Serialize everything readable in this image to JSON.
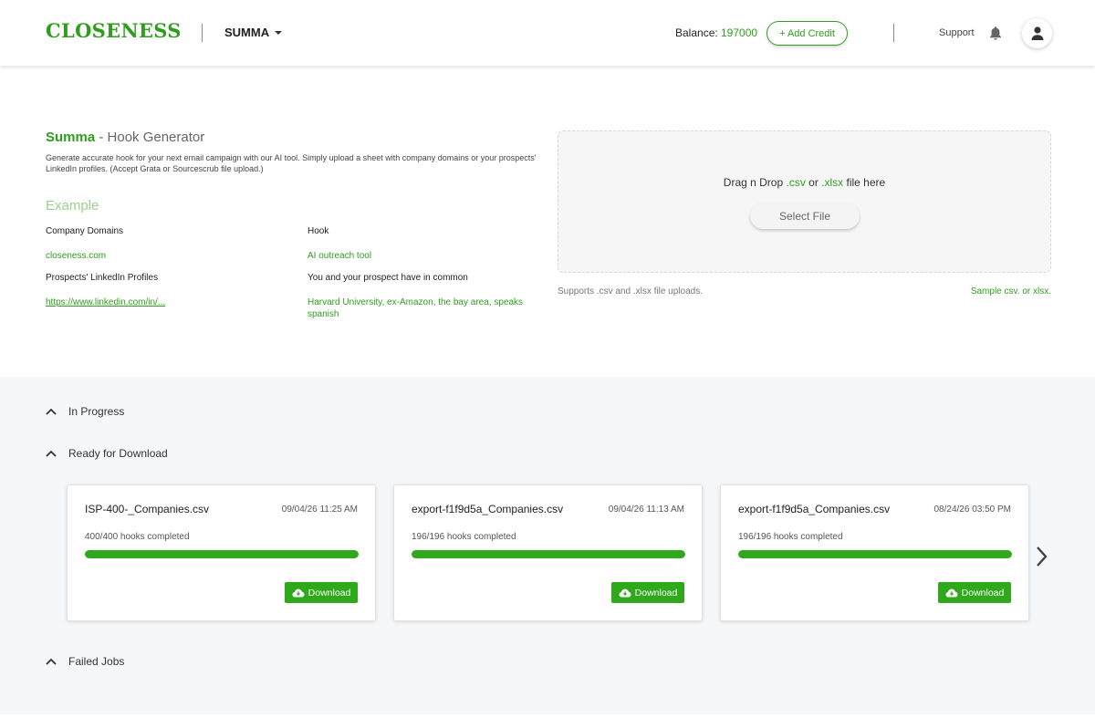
{
  "header": {
    "logo": "CLOSENESS",
    "workspace": "SUMMA",
    "balance_label": "Balance:",
    "balance_value": "197000",
    "add_credit_label": "+ Add Credit",
    "support_label": "Support",
    "icons": {
      "bell": "bell-icon",
      "user": "user-icon",
      "caret": "caret-down-icon"
    }
  },
  "intro": {
    "brand": "Summa",
    "title_suffix": " - Hook Generator",
    "description": "Generate accurate hook for your next email campaign with our AI tool. Simply upload a sheet with company domains or your prospects' LinkedIn profiles. (Accept Grata or Sourcescrub file upload.)",
    "example_title": "Example",
    "examples": [
      {
        "label": "Company Domains",
        "value": "closeness.com"
      },
      {
        "label": "Hook",
        "value": "AI outreach tool"
      },
      {
        "label": "Prospects' LinkedIn Profiles",
        "value": "https://www.linkedin.com/in/..."
      },
      {
        "label": "You and your prospect have in common",
        "value": "Harvard University, ex-Amazon, the bay area, speaks spanish"
      }
    ]
  },
  "upload": {
    "drag_prefix": "Drag n Drop ",
    "csv": ".csv",
    "or": " or ",
    "xlsx": ".xlsx",
    "drag_suffix": " file here",
    "select_file_label": "Select File",
    "supports_text": "Supports .csv and .xlsx file uploads.",
    "sample_text": "Sample csv. or xlsx."
  },
  "jobs": {
    "in_progress_label": "In Progress",
    "ready_label": "Ready for Download",
    "failed_label": "Failed Jobs",
    "download_label": "Download",
    "cards": [
      {
        "name": "ISP-400-_Companies.csv",
        "date": "09/04/26 11:25 AM",
        "status": "400/400 hooks completed",
        "progress": 1.0
      },
      {
        "name": "export-f1f9d5a_Companies.csv",
        "date": "09/04/26 11:13 AM",
        "status": "196/196 hooks completed",
        "progress": 1.0
      },
      {
        "name": "export-f1f9d5a_Companies.csv",
        "date": "08/24/26 03:50 PM",
        "status": "196/196 hooks completed",
        "progress": 1.0
      }
    ]
  },
  "colors": {
    "brand_green": "#2f9e1e",
    "progress_green": "#2fa81c",
    "light_green": "#9bd18a",
    "jobs_background": "#f6f7f8"
  }
}
